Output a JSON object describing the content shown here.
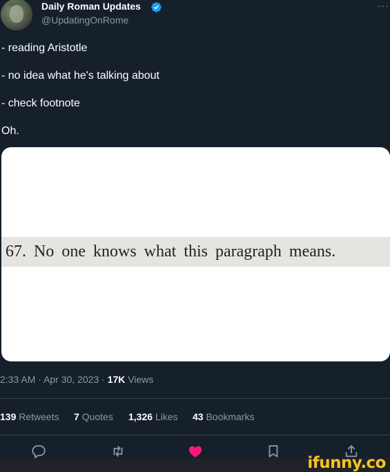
{
  "tweet": {
    "display_name": "Daily Roman Updates",
    "handle": "@UpdatingOnRome",
    "more_label": "···",
    "lines": [
      "- reading Aristotle",
      "- no idea what he's talking about",
      "- check footnote",
      "Oh."
    ],
    "media": {
      "footnote_text": "67. No one knows what this paragraph means."
    },
    "time": "2:33 AM",
    "date": "Apr 30, 2023",
    "separator": "·",
    "views_count": "17K",
    "views_label": "Views"
  },
  "stats": {
    "retweets": {
      "count": "139",
      "label": "Retweets"
    },
    "quotes": {
      "count": "7",
      "label": "Quotes"
    },
    "likes": {
      "count": "1,326",
      "label": "Likes"
    },
    "bookmarks": {
      "count": "43",
      "label": "Bookmarks"
    }
  },
  "actions": [
    "reply-icon",
    "retweet-icon",
    "like-icon",
    "bookmark-icon",
    "share-icon"
  ],
  "colors": {
    "background": "#15202b",
    "secondary_text": "#8b98a5",
    "verified": "#1d9bf0",
    "like_active": "#f91880",
    "watermark": "#f7c325"
  },
  "watermark": "ifunny.co"
}
